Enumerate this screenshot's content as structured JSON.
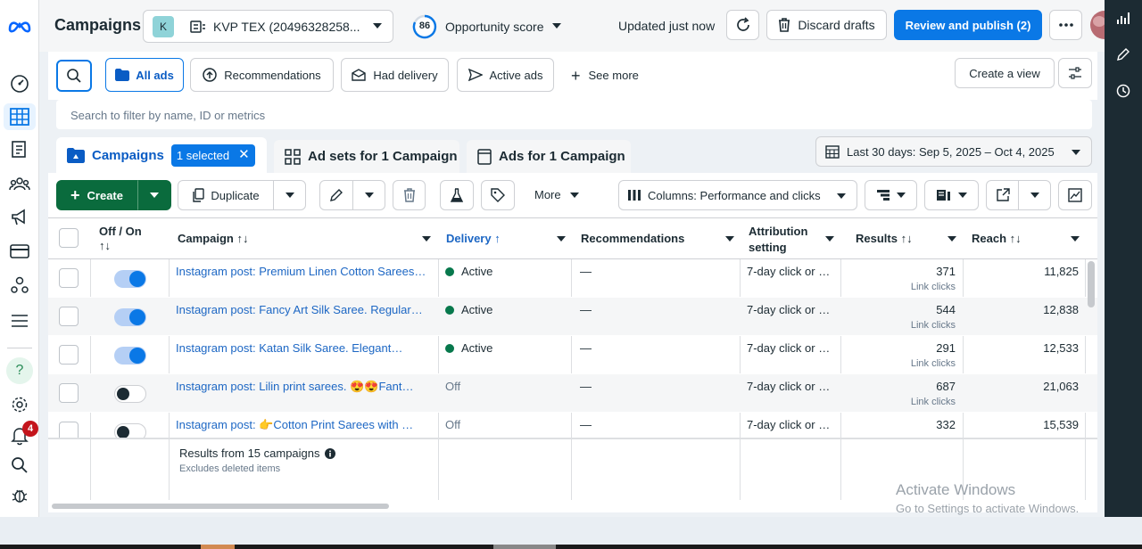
{
  "header": {
    "title": "Campaigns",
    "account_initial": "K",
    "account_name": "KVP TEX (20496328258...",
    "opportunity_score": "86",
    "opportunity_label": "Opportunity score",
    "updated": "Updated just now",
    "discard": "Discard drafts",
    "review": "Review and publish (2)"
  },
  "filters": {
    "all_ads": "All ads",
    "recommendations": "Recommendations",
    "had_delivery": "Had delivery",
    "active_ads": "Active ads",
    "see_more": "See more",
    "create_view": "Create a view",
    "search_placeholder": "Search to filter by name, ID or metrics"
  },
  "tabs": {
    "campaigns": "Campaigns",
    "selected": "1 selected",
    "adsets": "Ad sets for 1 Campaign",
    "ads": "Ads for 1 Campaign",
    "date_range": "Last 30 days: Sep 5, 2025 – Oct 4, 2025"
  },
  "toolbar": {
    "create": "Create",
    "duplicate": "Duplicate",
    "more": "More",
    "columns": "Columns: Performance and clicks"
  },
  "table": {
    "headers": {
      "offon": "Off / On",
      "campaign": "Campaign",
      "delivery": "Delivery",
      "recommendations": "Recommendations",
      "attribution1": "Attribution",
      "attribution2": "setting",
      "results": "Results",
      "reach": "Reach"
    },
    "rows": [
      {
        "on": true,
        "name": "Instagram post: Premium Linen Cotton Sarees…",
        "delivery": "Active",
        "recommendations": "—",
        "attribution": "7-day click or …",
        "results": "371",
        "result_type": "Link clicks",
        "reach": "11,825"
      },
      {
        "on": true,
        "name": "Instagram post: Fancy Art Silk Saree. Regular…",
        "delivery": "Active",
        "recommendations": "—",
        "attribution": "7-day click or …",
        "results": "544",
        "result_type": "Link clicks",
        "reach": "12,838"
      },
      {
        "on": true,
        "name": "Instagram post: Katan Silk Saree. Elegant…",
        "delivery": "Active",
        "recommendations": "—",
        "attribution": "7-day click or …",
        "results": "291",
        "result_type": "Link clicks",
        "reach": "12,533"
      },
      {
        "on": false,
        "name": "Instagram post: Lilin print sarees. 😍😍Fant…",
        "delivery": "Off",
        "recommendations": "—",
        "attribution": "7-day click or …",
        "results": "687",
        "result_type": "Link clicks",
        "reach": "21,063"
      },
      {
        "on": false,
        "name": "Instagram post: 👉Cotton Print Sarees with …",
        "delivery": "Off",
        "recommendations": "—",
        "attribution": "7-day click or …",
        "results": "332",
        "result_type": "",
        "reach": "15,539"
      }
    ],
    "footer_title": "Results from 15 campaigns",
    "footer_sub": "Excludes deleted items"
  },
  "nav": {
    "notifications_count": "4"
  },
  "watermark": {
    "title": "Activate Windows",
    "sub": "Go to Settings to activate Windows."
  }
}
